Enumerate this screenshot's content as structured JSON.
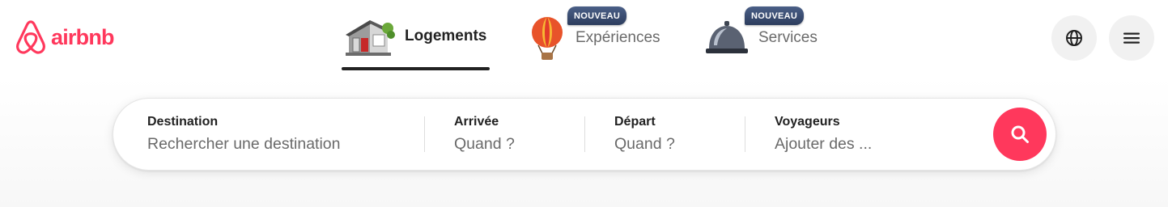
{
  "brand": {
    "name": "airbnb",
    "color": "#ff385c",
    "logo_icon": "airbnb-belo-icon"
  },
  "nav": {
    "tabs": [
      {
        "label": "Logements",
        "icon": "house-icon",
        "active": true
      },
      {
        "label": "Expériences",
        "icon": "hot-air-balloon-icon",
        "badge": "NOUVEAU",
        "active": false
      },
      {
        "label": "Services",
        "icon": "service-bell-icon",
        "badge": "NOUVEAU",
        "active": false
      }
    ]
  },
  "header_actions": {
    "language_icon": "globe-icon",
    "menu_icon": "hamburger-menu-icon"
  },
  "search": {
    "destination": {
      "label": "Destination",
      "placeholder": "Rechercher une destination"
    },
    "checkin": {
      "label": "Arrivée",
      "placeholder": "Quand ?"
    },
    "checkout": {
      "label": "Départ",
      "placeholder": "Quand ?"
    },
    "guests": {
      "label": "Voyageurs",
      "placeholder": "Ajouter des ..."
    },
    "button_icon": "search-icon",
    "button_color": "#ff385c"
  }
}
